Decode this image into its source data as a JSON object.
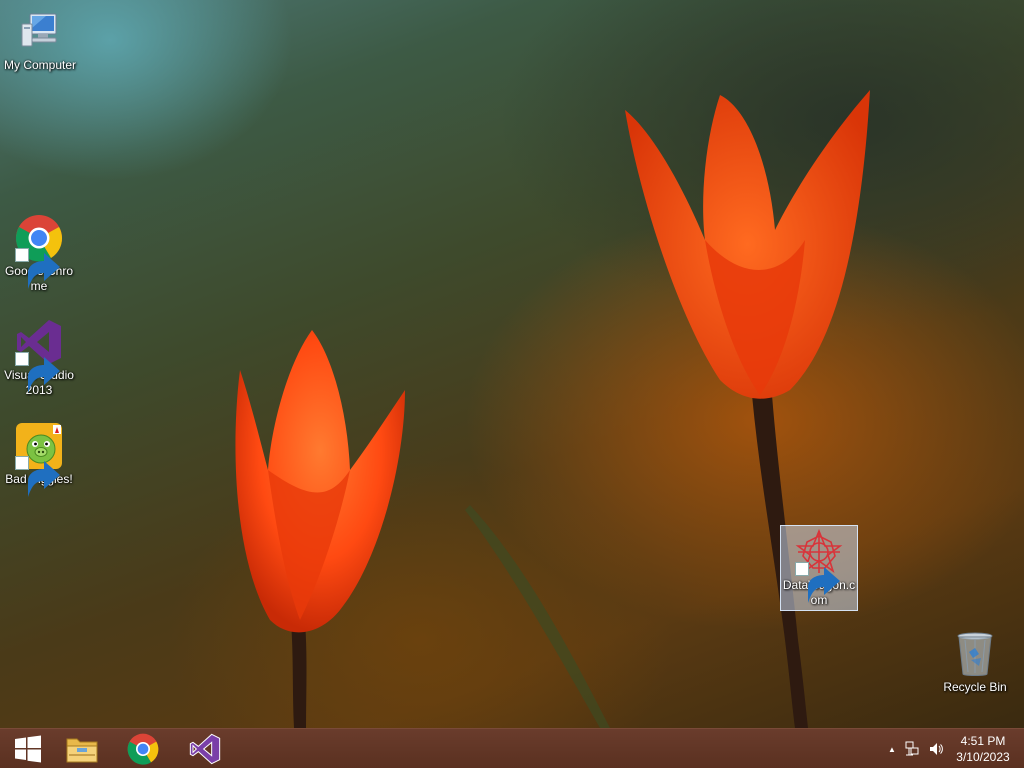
{
  "desktop": {
    "icons": [
      {
        "label": "My Computer",
        "icon": "my-computer-icon"
      },
      {
        "label": "Google Chrome",
        "icon": "chrome-icon"
      },
      {
        "label": "Visual Studio 2013",
        "icon": "visual-studio-icon"
      },
      {
        "label": "Bad Piggies!",
        "icon": "bad-piggies-icon"
      },
      {
        "label": "DataWagon.com",
        "icon": "datawagon-icon",
        "selected": true
      },
      {
        "label": "Recycle Bin",
        "icon": "recycle-bin-icon"
      }
    ]
  },
  "taskbar": {
    "pinned": [
      {
        "icon": "windows-start-icon"
      },
      {
        "icon": "file-explorer-icon"
      },
      {
        "icon": "chrome-icon"
      },
      {
        "icon": "visual-studio-icon"
      }
    ],
    "tray": {
      "show_hidden": "▲",
      "network_icon": "network-icon",
      "volume_icon": "volume-icon"
    },
    "clock": {
      "time": "4:51 PM",
      "date": "3/10/2023"
    }
  },
  "colors": {
    "taskbar": "#5e3322",
    "tulip": "#ff4a12",
    "selection": "#c8d7eb"
  }
}
